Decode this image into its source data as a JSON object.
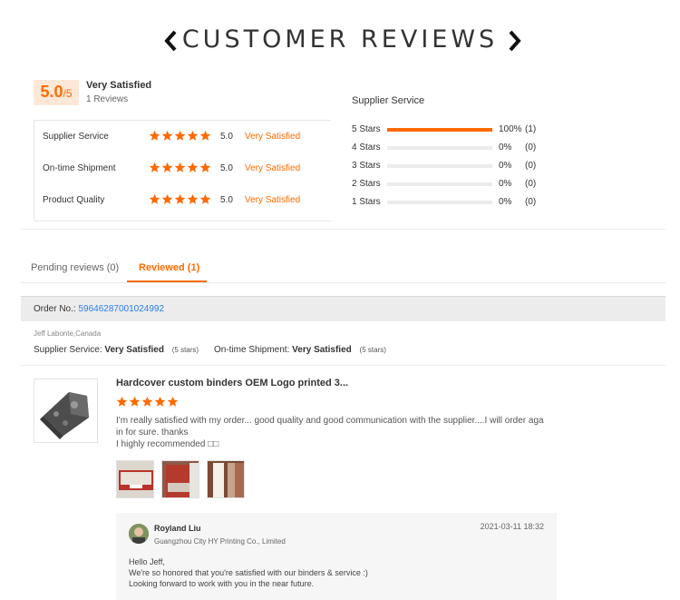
{
  "header": {
    "title": "CUSTOMER REVIEWS"
  },
  "summary": {
    "score": "5.0",
    "score_out_of": "/5",
    "label": "Very Satisfied",
    "review_count": "1 Reviews",
    "ratings": [
      {
        "label": "Supplier Service",
        "score": "5.0",
        "text": "Very Satisfied",
        "stars": 5
      },
      {
        "label": "On-time Shipment",
        "score": "5.0",
        "text": "Very Satisfied",
        "stars": 5
      },
      {
        "label": "Product Quality",
        "score": "5.0",
        "text": "Very Satisfied",
        "stars": 5
      }
    ]
  },
  "distribution": {
    "title": "Supplier Service",
    "rows": [
      {
        "label": "5 Stars",
        "fraction": 1.0,
        "percent": "100%",
        "count": "(1)"
      },
      {
        "label": "4 Stars",
        "fraction": 0,
        "percent": "0%",
        "count": "(0)"
      },
      {
        "label": "3 Stars",
        "fraction": 0,
        "percent": "0%",
        "count": "(0)"
      },
      {
        "label": "2 Stars",
        "fraction": 0,
        "percent": "0%",
        "count": "(0)"
      },
      {
        "label": "1 Stars",
        "fraction": 0,
        "percent": "0%",
        "count": "(0)"
      }
    ]
  },
  "tabs": {
    "pending": "Pending reviews (0)",
    "reviewed": "Reviewed (1)"
  },
  "order": {
    "label": "Order No.:",
    "number": "59646287001024992"
  },
  "review": {
    "reviewer": "Jeff Labonte,Canada",
    "supplier_service_label": "Supplier Service:",
    "supplier_service_value": "Very Satisfied",
    "supplier_service_stars": "(5 stars)",
    "shipment_label": "On-time Shipment:",
    "shipment_value": "Very Satisfied",
    "shipment_stars": "(5 stars)",
    "product_title": "Hardcover custom binders OEM Logo printed 3...",
    "stars": 5,
    "text_line1": "I'm really satisfied with my order... good quality and good communication with the supplier....I will order aga",
    "text_line2": "in for sure. thanks",
    "text_line3": "I highly recommended □□"
  },
  "reply": {
    "name": "Royland Liu",
    "company": "Guangzhou City HY Printing Co., Limited",
    "date": "2021-03-11 18:32",
    "line1": "Hello Jeff,",
    "line2": "We're so honored that you're satisfied with our binders & service :)",
    "line3": "Looking forward to work with you in the near future."
  },
  "colors": {
    "accent": "#ff6a00",
    "link": "#2b7de9"
  },
  "icons": [
    "chevron-left-icon",
    "chevron-right-icon",
    "star-icon"
  ]
}
